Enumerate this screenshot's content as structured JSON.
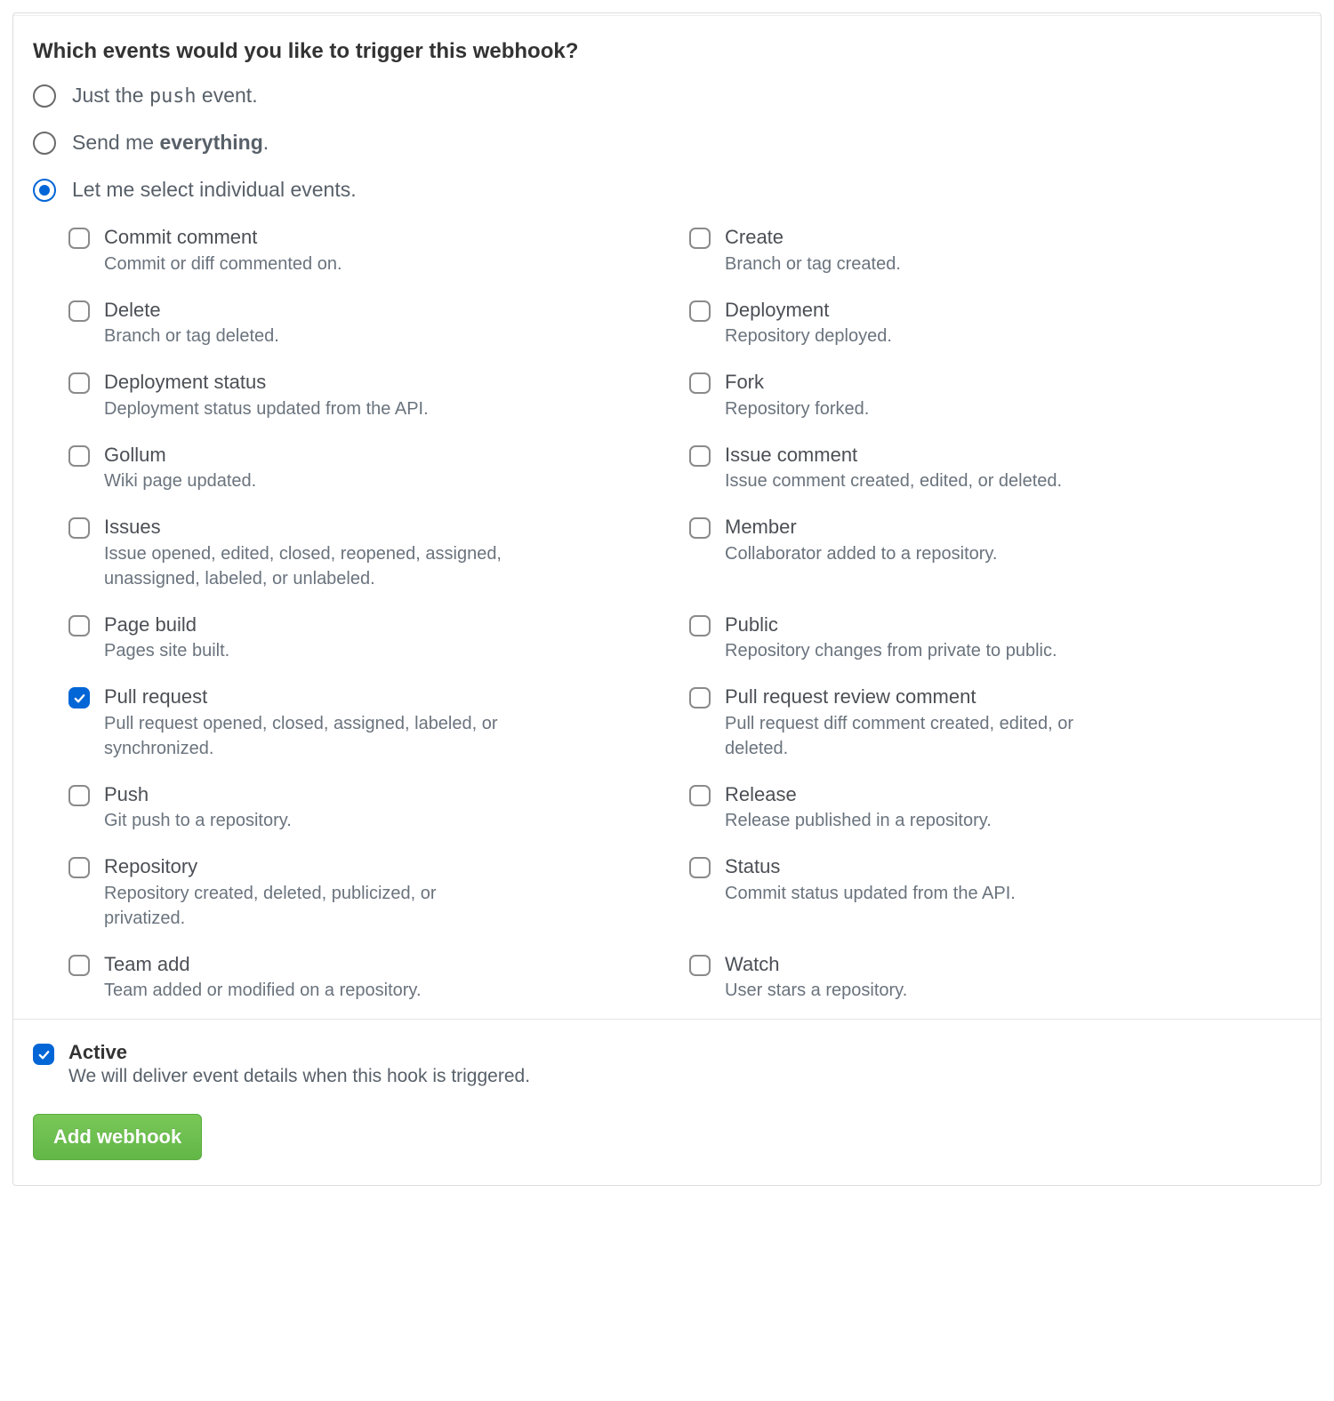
{
  "heading": "Which events would you like to trigger this webhook?",
  "radios": {
    "push_pre": "Just the ",
    "push_code": "push",
    "push_post": " event.",
    "everything_pre": "Send me ",
    "everything_strong": "everything",
    "everything_post": ".",
    "individual": "Let me select individual events.",
    "selected_index": 2
  },
  "events": [
    {
      "id": "commit-comment",
      "title": "Commit comment",
      "desc": "Commit or diff commented on.",
      "checked": false
    },
    {
      "id": "create",
      "title": "Create",
      "desc": "Branch or tag created.",
      "checked": false
    },
    {
      "id": "delete",
      "title": "Delete",
      "desc": "Branch or tag deleted.",
      "checked": false
    },
    {
      "id": "deployment",
      "title": "Deployment",
      "desc": "Repository deployed.",
      "checked": false
    },
    {
      "id": "deployment-status",
      "title": "Deployment status",
      "desc": "Deployment status updated from the API.",
      "checked": false
    },
    {
      "id": "fork",
      "title": "Fork",
      "desc": "Repository forked.",
      "checked": false
    },
    {
      "id": "gollum",
      "title": "Gollum",
      "desc": "Wiki page updated.",
      "checked": false
    },
    {
      "id": "issue-comment",
      "title": "Issue comment",
      "desc": "Issue comment created, edited, or deleted.",
      "checked": false
    },
    {
      "id": "issues",
      "title": "Issues",
      "desc": "Issue opened, edited, closed, reopened, assigned, unassigned, labeled, or unlabeled.",
      "checked": false
    },
    {
      "id": "member",
      "title": "Member",
      "desc": "Collaborator added to a repository.",
      "checked": false
    },
    {
      "id": "page-build",
      "title": "Page build",
      "desc": "Pages site built.",
      "checked": false
    },
    {
      "id": "public",
      "title": "Public",
      "desc": "Repository changes from private to public.",
      "checked": false
    },
    {
      "id": "pull-request",
      "title": "Pull request",
      "desc": "Pull request opened, closed, assigned, labeled, or synchronized.",
      "checked": true
    },
    {
      "id": "pull-request-review-comment",
      "title": "Pull request review comment",
      "desc": "Pull request diff comment created, edited, or deleted.",
      "checked": false
    },
    {
      "id": "push",
      "title": "Push",
      "desc": "Git push to a repository.",
      "checked": false
    },
    {
      "id": "release",
      "title": "Release",
      "desc": "Release published in a repository.",
      "checked": false
    },
    {
      "id": "repository",
      "title": "Repository",
      "desc": "Repository created, deleted, publicized, or privatized.",
      "checked": false
    },
    {
      "id": "status",
      "title": "Status",
      "desc": "Commit status updated from the API.",
      "checked": false
    },
    {
      "id": "team-add",
      "title": "Team add",
      "desc": "Team added or modified on a repository.",
      "checked": false
    },
    {
      "id": "watch",
      "title": "Watch",
      "desc": "User stars a repository.",
      "checked": false
    }
  ],
  "active": {
    "checked": true,
    "title": "Active",
    "desc": "We will deliver event details when this hook is triggered."
  },
  "submit_label": "Add webhook"
}
